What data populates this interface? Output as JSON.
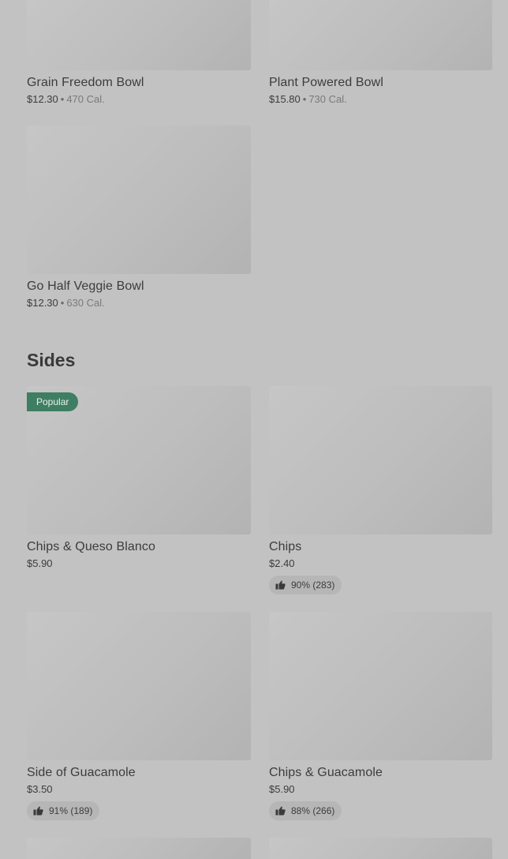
{
  "bowls": [
    {
      "name": "Grain Freedom Bowl",
      "price": "$12.30",
      "calories": "470 Cal."
    },
    {
      "name": "Plant Powered Bowl",
      "price": "$15.80",
      "calories": "730 Cal."
    },
    {
      "name": "Go Half Veggie Bowl",
      "price": "$12.30",
      "calories": "630 Cal."
    }
  ],
  "sides": {
    "title": "Sides",
    "items": [
      {
        "name": "Chips & Queso Blanco",
        "price": "$5.90",
        "badge": "Popular"
      },
      {
        "name": "Chips",
        "price": "$2.40",
        "rating": "90% (283)"
      },
      {
        "name": "Side of Guacamole",
        "price": "$3.50",
        "rating": "91% (189)"
      },
      {
        "name": "Chips & Guacamole",
        "price": "$5.90",
        "rating": "88% (266)"
      }
    ]
  },
  "separator": "•",
  "icons": {
    "rating": "thumbs-up-icon"
  },
  "colors": {
    "background": "#c2c2c2",
    "badge": "#3f7e63",
    "rating_pill": "#b6b6b6"
  }
}
